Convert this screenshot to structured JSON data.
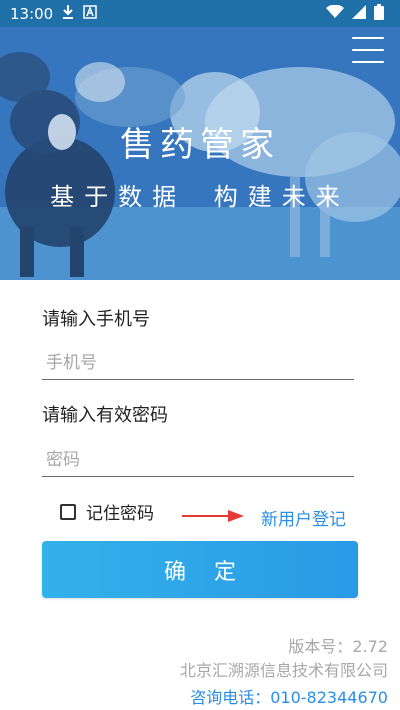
{
  "status_bar": {
    "time": "13:00",
    "icons_left": [
      "download-icon",
      "a-letter-icon"
    ],
    "icons_right": [
      "wifi-icon",
      "signal-icon",
      "battery-icon"
    ]
  },
  "hero": {
    "title": "售药管家",
    "subtitle": "基于数据  构建未来"
  },
  "form": {
    "phone_label": "请输入手机号",
    "phone_placeholder": "手机号",
    "password_label": "请输入有效密码",
    "password_placeholder": "密码",
    "remember_label": "记住密码",
    "register_link": "新用户登记",
    "confirm_button": "确定"
  },
  "footer": {
    "version": "版本号：2.72",
    "company": "北京汇溯源信息技术有限公司",
    "phone": "咨询电话：010-82344670"
  },
  "colors": {
    "accent": "#2a8ee6",
    "button": "#33b1ea",
    "arrow": "#e53935",
    "status_bar": "#1f6fa8"
  }
}
